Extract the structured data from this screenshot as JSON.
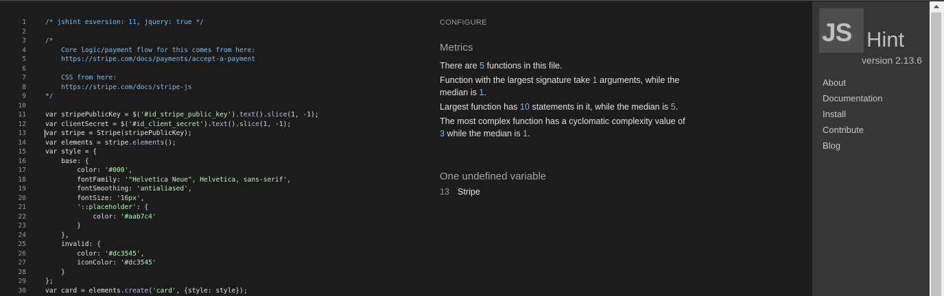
{
  "editor": {
    "lines": [
      {
        "n": "1",
        "tokens": [
          {
            "t": "comment",
            "v": "/* jshint esversion: 11, jquery: true */"
          }
        ]
      },
      {
        "n": "2",
        "tokens": []
      },
      {
        "n": "3",
        "tokens": [
          {
            "t": "comment",
            "v": "/*"
          }
        ]
      },
      {
        "n": "4",
        "tokens": [
          {
            "t": "comment",
            "v": "    Core logic/payment flow for this comes from here:"
          }
        ]
      },
      {
        "n": "5",
        "tokens": [
          {
            "t": "comment",
            "v": "    https://stripe.com/docs/payments/accept-a-payment"
          }
        ]
      },
      {
        "n": "6",
        "tokens": []
      },
      {
        "n": "7",
        "tokens": [
          {
            "t": "comment",
            "v": "    CSS from here:"
          }
        ]
      },
      {
        "n": "8",
        "tokens": [
          {
            "t": "comment",
            "v": "    https://stripe.com/docs/stripe-js"
          }
        ]
      },
      {
        "n": "9",
        "tokens": [
          {
            "t": "comment",
            "v": "*/"
          }
        ]
      },
      {
        "n": "10",
        "tokens": []
      },
      {
        "n": "11",
        "tokens": [
          {
            "t": "plain",
            "v": "var stripePublicKey = $("
          },
          {
            "t": "string",
            "v": "'#id_stripe_public_key'"
          },
          {
            "t": "plain",
            "v": ")."
          },
          {
            "t": "method",
            "v": "text"
          },
          {
            "t": "plain",
            "v": "()."
          },
          {
            "t": "method",
            "v": "slice"
          },
          {
            "t": "plain",
            "v": "(1, -1);"
          }
        ]
      },
      {
        "n": "12",
        "tokens": [
          {
            "t": "plain",
            "v": "var clientSecret = $("
          },
          {
            "t": "string",
            "v": "'#id_client_secret'"
          },
          {
            "t": "plain",
            "v": ")."
          },
          {
            "t": "method",
            "v": "text"
          },
          {
            "t": "plain",
            "v": "()."
          },
          {
            "t": "method",
            "v": "slice"
          },
          {
            "t": "plain",
            "v": "(1, -1);"
          }
        ]
      },
      {
        "n": "13",
        "tokens": [
          {
            "t": "plain",
            "v": "var stripe = Stripe(stripePublicKey);"
          }
        ]
      },
      {
        "n": "14",
        "tokens": [
          {
            "t": "plain",
            "v": "var elements = stripe."
          },
          {
            "t": "method",
            "v": "elements"
          },
          {
            "t": "plain",
            "v": "();"
          }
        ]
      },
      {
        "n": "15",
        "tokens": [
          {
            "t": "plain",
            "v": "var style = {"
          }
        ]
      },
      {
        "n": "16",
        "tokens": [
          {
            "t": "plain",
            "v": "    base: {"
          }
        ]
      },
      {
        "n": "17",
        "tokens": [
          {
            "t": "plain",
            "v": "        color: "
          },
          {
            "t": "string",
            "v": "'#000'"
          },
          {
            "t": "plain",
            "v": ","
          }
        ]
      },
      {
        "n": "18",
        "tokens": [
          {
            "t": "plain",
            "v": "        fontFamily: "
          },
          {
            "t": "string",
            "v": "'\"Helvetica Neue\", Helvetica, sans-serif'"
          },
          {
            "t": "plain",
            "v": ","
          }
        ]
      },
      {
        "n": "19",
        "tokens": [
          {
            "t": "plain",
            "v": "        fontSmoothing: "
          },
          {
            "t": "string",
            "v": "'antialiased'"
          },
          {
            "t": "plain",
            "v": ","
          }
        ]
      },
      {
        "n": "20",
        "tokens": [
          {
            "t": "plain",
            "v": "        fontSize: "
          },
          {
            "t": "string",
            "v": "'16px'"
          },
          {
            "t": "plain",
            "v": ","
          }
        ]
      },
      {
        "n": "21",
        "tokens": [
          {
            "t": "plain",
            "v": "        "
          },
          {
            "t": "string",
            "v": "'::placeholder'"
          },
          {
            "t": "plain",
            "v": ": {"
          }
        ]
      },
      {
        "n": "22",
        "tokens": [
          {
            "t": "plain",
            "v": "            color: "
          },
          {
            "t": "string",
            "v": "'#aab7c4'"
          }
        ]
      },
      {
        "n": "23",
        "tokens": [
          {
            "t": "plain",
            "v": "        }"
          }
        ]
      },
      {
        "n": "24",
        "tokens": [
          {
            "t": "plain",
            "v": "    },"
          }
        ]
      },
      {
        "n": "25",
        "tokens": [
          {
            "t": "plain",
            "v": "    invalid: {"
          }
        ]
      },
      {
        "n": "26",
        "tokens": [
          {
            "t": "plain",
            "v": "        color: "
          },
          {
            "t": "string",
            "v": "'#dc3545'"
          },
          {
            "t": "plain",
            "v": ","
          }
        ]
      },
      {
        "n": "27",
        "tokens": [
          {
            "t": "plain",
            "v": "        iconColor: "
          },
          {
            "t": "string",
            "v": "'#dc3545'"
          }
        ]
      },
      {
        "n": "28",
        "tokens": [
          {
            "t": "plain",
            "v": "    }"
          }
        ]
      },
      {
        "n": "29",
        "tokens": [
          {
            "t": "plain",
            "v": "};"
          }
        ]
      },
      {
        "n": "30",
        "tokens": [
          {
            "t": "plain",
            "v": "var card = elements."
          },
          {
            "t": "method",
            "v": "create"
          },
          {
            "t": "plain",
            "v": "("
          },
          {
            "t": "string",
            "v": "'card'"
          },
          {
            "t": "plain",
            "v": ", {style: style});"
          }
        ]
      }
    ]
  },
  "report": {
    "configure_label": "CONFIGURE",
    "metrics": {
      "title": "Metrics",
      "line1": {
        "a": "There are ",
        "b": "5",
        "c": " functions in this file."
      },
      "line2": {
        "a": "Function with the largest signature take ",
        "b": "1",
        "c": " arguments, while the median is ",
        "d": "1",
        "e": "."
      },
      "line3": {
        "a": "Largest function has ",
        "b": "10",
        "c": " statements in it, while the median is ",
        "d": "5",
        "e": "."
      },
      "line4": {
        "a": "The most complex function has a cyclomatic complexity value of ",
        "b": "3",
        "c": " while the median is ",
        "d": "1",
        "e": "."
      }
    },
    "undefined": {
      "title": "One undefined variable",
      "line": "13",
      "name": "Stripe"
    }
  },
  "sidebar": {
    "logo_js": "JS",
    "logo_hint": "Hint",
    "version": "version 2.13.6",
    "nav": [
      "About",
      "Documentation",
      "Install",
      "Contribute",
      "Blog"
    ]
  },
  "colors": {
    "background": "#1c1c1c",
    "sidebar": "#363636",
    "highlight": "#7fb8f0",
    "comment": "#7cc1f5",
    "string": "#b8f4b8"
  }
}
